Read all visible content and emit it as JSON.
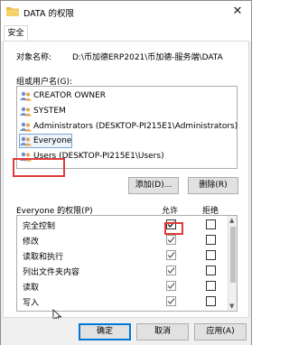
{
  "window": {
    "title": "DATA 的权限",
    "close": "✕"
  },
  "tabs": [
    {
      "label": "安全"
    }
  ],
  "object": {
    "label": "对象名称:",
    "value": "D:\\币加德ERP2021\\币加德-服务端\\DATA"
  },
  "groups": {
    "label": "组或用户名(G):",
    "items": [
      {
        "label": "CREATOR OWNER"
      },
      {
        "label": "SYSTEM"
      },
      {
        "label": "Administrators (DESKTOP-PI215E1\\Administrators)"
      },
      {
        "label": "Everyone"
      },
      {
        "label": "Users (DESKTOP-PI215E1\\Users)"
      }
    ],
    "selected": "Everyone"
  },
  "buttons": {
    "add": "添加(D)...",
    "remove": "删除(R)",
    "ok": "确定",
    "cancel": "取消",
    "apply": "应用(A)"
  },
  "permissions": {
    "title": "Everyone 的权限(P)",
    "allow_header": "允许",
    "deny_header": "拒绝",
    "rows": [
      {
        "name": "完全控制",
        "allow": true,
        "deny": false
      },
      {
        "name": "修改",
        "allow": true,
        "deny": false
      },
      {
        "name": "读取和执行",
        "allow": true,
        "deny": false
      },
      {
        "name": "列出文件夹内容",
        "allow": true,
        "deny": false
      },
      {
        "name": "读取",
        "allow": true,
        "deny": false
      },
      {
        "name": "写入",
        "allow": true,
        "deny": false
      }
    ]
  },
  "colors": {
    "highlight": "#e23b3b",
    "accent": "#0078d7"
  }
}
